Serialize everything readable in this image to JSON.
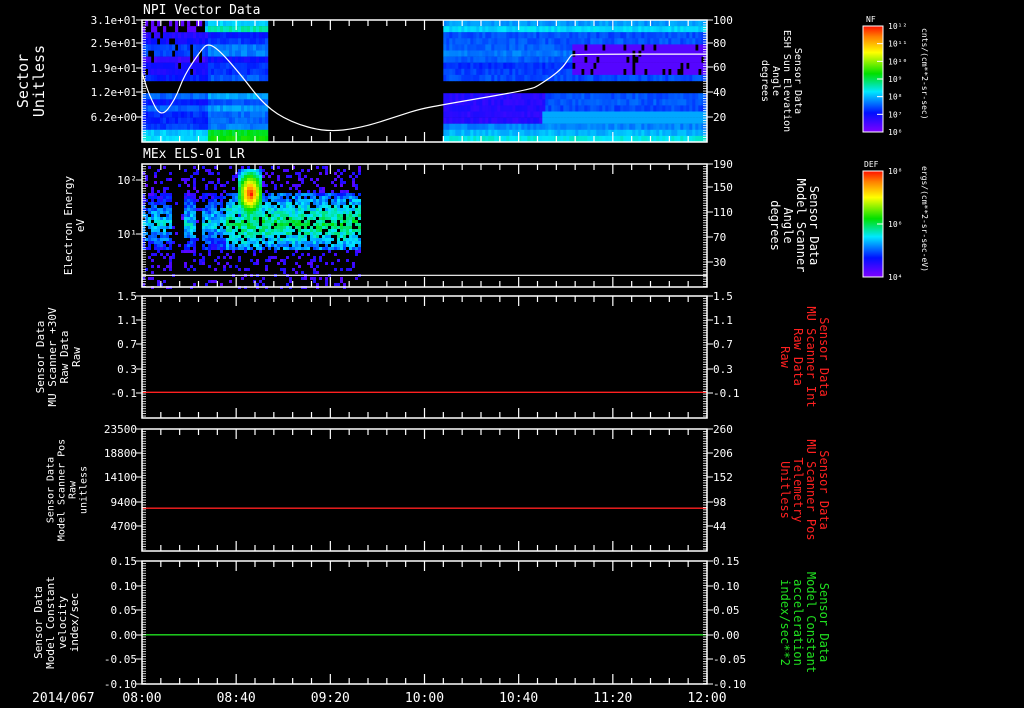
{
  "chart_data": [
    {
      "type": "heatmap",
      "title": "NPI Vector Data",
      "ylabel": [
        "Sector",
        "Unitless"
      ],
      "yticks": [
        "3.1e+01",
        "2.5e+01",
        "1.9e+01",
        "1.2e+01",
        "6.2e+00"
      ],
      "ylim": [
        0,
        31
      ],
      "data_intervals": [
        [
          "08:00",
          "08:53"
        ],
        [
          "10:08",
          "12:00"
        ]
      ],
      "colorbar": {
        "label": "NF",
        "ticks": [
          "10¹²",
          "10¹¹",
          "10¹⁰",
          "10⁹",
          "10⁸",
          "10⁷",
          "10⁶"
        ],
        "units": "cnts/(cm**2-sr-sec)",
        "scale": "log"
      },
      "overlay": {
        "type": "line",
        "color": "#ffffff",
        "ylabel": [
          "Sensor Data",
          "ESH Sun Elevation",
          "Angle",
          "degrees"
        ],
        "yticks": [
          "100",
          "80",
          "60",
          "40",
          "20"
        ],
        "ylim": [
          0,
          100
        ],
        "x": [
          "08:00",
          "08:03",
          "08:08",
          "08:14",
          "08:18",
          "08:25",
          "08:28",
          "08:33",
          "08:42",
          "08:52",
          "09:03",
          "09:18",
          "09:33",
          "09:50",
          "09:58",
          "10:09",
          "10:45",
          "10:49",
          "10:58",
          "11:02",
          "11:03",
          "12:00"
        ],
        "y": [
          57,
          38.5,
          19.7,
          34.4,
          55,
          75,
          81,
          75,
          55,
          30,
          16.4,
          8.2,
          11.5,
          22,
          27,
          31,
          43,
          47,
          59,
          70.5,
          72,
          72
        ]
      }
    },
    {
      "type": "heatmap",
      "title": "MEx ELS-01 LR",
      "ylabel": [
        "Electron Energy",
        "eV"
      ],
      "yticks": [
        "10²",
        "10¹"
      ],
      "yscale": "log",
      "ylim": [
        1,
        200
      ],
      "data_intervals": [
        [
          "08:00",
          "09:32"
        ]
      ],
      "features": {
        "peak_time": [
          "08:40",
          "08:47"
        ],
        "peak_energy_eV": [
          50,
          100
        ]
      },
      "colorbar": {
        "label": "DEF",
        "ticks": [
          "10⁸",
          "10⁶",
          "10⁴"
        ],
        "units": "ergs/(cm**2-sr-sec-eV)",
        "scale": "log"
      },
      "overlay": {
        "type": "line",
        "color": "#ffffff",
        "ylabel": [
          "Sensor Data",
          "Model Scanner",
          "Angle",
          "degrees"
        ],
        "yticks": [
          "190",
          "150",
          "110",
          "70",
          "30"
        ],
        "ylim": [
          -10,
          190
        ],
        "x": [
          "08:00",
          "12:00"
        ],
        "y": [
          9,
          9
        ]
      }
    },
    {
      "type": "line",
      "ylabel": [
        "Sensor Data",
        "MU Scanner +30V",
        "Raw Data",
        "Raw"
      ],
      "yticks": [
        "1.5",
        "1.1",
        "0.7",
        "0.3",
        "-0.1"
      ],
      "ylim": [
        -0.4,
        1.5
      ],
      "series": [
        {
          "color": "#ff2020",
          "x": [
            "08:00",
            "12:00"
          ],
          "y": [
            0,
            0
          ]
        }
      ],
      "right_axis": {
        "ylabel": [
          "Sensor Data",
          "MU Scanner Int",
          "Raw Data",
          "Raw"
        ],
        "color": "#ff2020",
        "yticks": [
          "1.5",
          "1.1",
          "0.7",
          "0.3",
          "-0.1"
        ],
        "ylim": [
          -0.4,
          1.5
        ]
      }
    },
    {
      "type": "line",
      "ylabel": [
        "Sensor Data",
        "Model Scanner Pos",
        "Raw",
        "unitless"
      ],
      "yticks": [
        "23500",
        "18800",
        "14100",
        "9400",
        "4700"
      ],
      "ylim": [
        0,
        23500
      ],
      "series": [
        {
          "color": "#ff2020",
          "x": [
            "08:00",
            "12:00"
          ],
          "y": [
            8250,
            8250
          ]
        }
      ],
      "right_axis": {
        "ylabel": [
          "Sensor Data",
          "MU Scanner Pos",
          "Telemetry",
          "Unitless"
        ],
        "color": "#ff2020",
        "yticks": [
          "260",
          "206",
          "152",
          "98",
          "44"
        ],
        "ylim": [
          -10,
          260
        ]
      }
    },
    {
      "type": "line",
      "ylabel": [
        "Sensor Data",
        "Model Constant",
        "velocity",
        "index/sec"
      ],
      "yticks": [
        "0.15",
        "0.10",
        "0.05",
        "0.00",
        "-0.05",
        "-0.10"
      ],
      "ylim": [
        -0.1,
        0.15
      ],
      "series": [
        {
          "color": "#20e020",
          "x": [
            "08:00",
            "12:00"
          ],
          "y": [
            0,
            0
          ]
        }
      ],
      "right_axis": {
        "ylabel": [
          "Sensor Data",
          "Model Constant",
          "acceleration",
          "index/sec**2"
        ],
        "color": "#20e020",
        "yticks": [
          "0.15",
          "0.10",
          "0.05",
          "0.00",
          "-0.05",
          "-0.10"
        ],
        "ylim": [
          -0.1,
          0.15
        ]
      }
    }
  ],
  "xaxis": {
    "date": "2014/067",
    "ticks": [
      "08:00",
      "08:40",
      "09:20",
      "10:00",
      "10:40",
      "11:20",
      "12:00"
    ],
    "xlim": [
      "08:00",
      "12:00"
    ]
  }
}
